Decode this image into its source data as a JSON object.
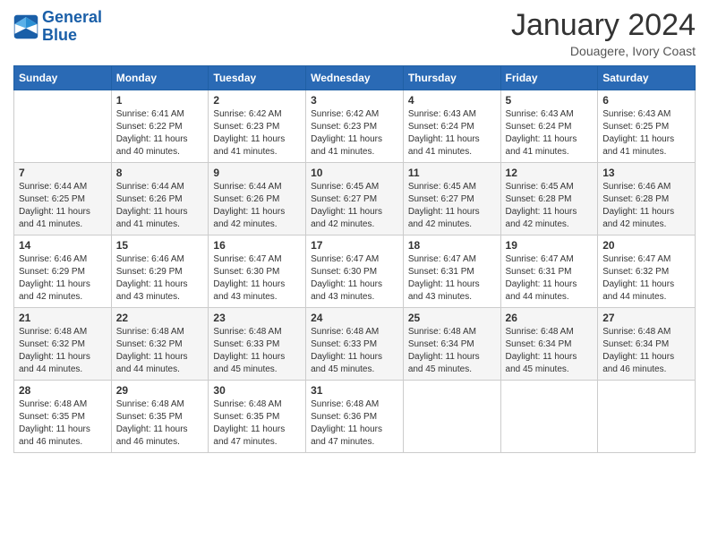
{
  "logo": {
    "line1": "General",
    "line2": "Blue"
  },
  "title": "January 2024",
  "subtitle": "Douagere, Ivory Coast",
  "days_header": [
    "Sunday",
    "Monday",
    "Tuesday",
    "Wednesday",
    "Thursday",
    "Friday",
    "Saturday"
  ],
  "weeks": [
    [
      {
        "day": "",
        "info": ""
      },
      {
        "day": "1",
        "info": "Sunrise: 6:41 AM\nSunset: 6:22 PM\nDaylight: 11 hours\nand 40 minutes."
      },
      {
        "day": "2",
        "info": "Sunrise: 6:42 AM\nSunset: 6:23 PM\nDaylight: 11 hours\nand 41 minutes."
      },
      {
        "day": "3",
        "info": "Sunrise: 6:42 AM\nSunset: 6:23 PM\nDaylight: 11 hours\nand 41 minutes."
      },
      {
        "day": "4",
        "info": "Sunrise: 6:43 AM\nSunset: 6:24 PM\nDaylight: 11 hours\nand 41 minutes."
      },
      {
        "day": "5",
        "info": "Sunrise: 6:43 AM\nSunset: 6:24 PM\nDaylight: 11 hours\nand 41 minutes."
      },
      {
        "day": "6",
        "info": "Sunrise: 6:43 AM\nSunset: 6:25 PM\nDaylight: 11 hours\nand 41 minutes."
      }
    ],
    [
      {
        "day": "7",
        "info": "Sunrise: 6:44 AM\nSunset: 6:25 PM\nDaylight: 11 hours\nand 41 minutes."
      },
      {
        "day": "8",
        "info": "Sunrise: 6:44 AM\nSunset: 6:26 PM\nDaylight: 11 hours\nand 41 minutes."
      },
      {
        "day": "9",
        "info": "Sunrise: 6:44 AM\nSunset: 6:26 PM\nDaylight: 11 hours\nand 42 minutes."
      },
      {
        "day": "10",
        "info": "Sunrise: 6:45 AM\nSunset: 6:27 PM\nDaylight: 11 hours\nand 42 minutes."
      },
      {
        "day": "11",
        "info": "Sunrise: 6:45 AM\nSunset: 6:27 PM\nDaylight: 11 hours\nand 42 minutes."
      },
      {
        "day": "12",
        "info": "Sunrise: 6:45 AM\nSunset: 6:28 PM\nDaylight: 11 hours\nand 42 minutes."
      },
      {
        "day": "13",
        "info": "Sunrise: 6:46 AM\nSunset: 6:28 PM\nDaylight: 11 hours\nand 42 minutes."
      }
    ],
    [
      {
        "day": "14",
        "info": "Sunrise: 6:46 AM\nSunset: 6:29 PM\nDaylight: 11 hours\nand 42 minutes."
      },
      {
        "day": "15",
        "info": "Sunrise: 6:46 AM\nSunset: 6:29 PM\nDaylight: 11 hours\nand 43 minutes."
      },
      {
        "day": "16",
        "info": "Sunrise: 6:47 AM\nSunset: 6:30 PM\nDaylight: 11 hours\nand 43 minutes."
      },
      {
        "day": "17",
        "info": "Sunrise: 6:47 AM\nSunset: 6:30 PM\nDaylight: 11 hours\nand 43 minutes."
      },
      {
        "day": "18",
        "info": "Sunrise: 6:47 AM\nSunset: 6:31 PM\nDaylight: 11 hours\nand 43 minutes."
      },
      {
        "day": "19",
        "info": "Sunrise: 6:47 AM\nSunset: 6:31 PM\nDaylight: 11 hours\nand 44 minutes."
      },
      {
        "day": "20",
        "info": "Sunrise: 6:47 AM\nSunset: 6:32 PM\nDaylight: 11 hours\nand 44 minutes."
      }
    ],
    [
      {
        "day": "21",
        "info": "Sunrise: 6:48 AM\nSunset: 6:32 PM\nDaylight: 11 hours\nand 44 minutes."
      },
      {
        "day": "22",
        "info": "Sunrise: 6:48 AM\nSunset: 6:32 PM\nDaylight: 11 hours\nand 44 minutes."
      },
      {
        "day": "23",
        "info": "Sunrise: 6:48 AM\nSunset: 6:33 PM\nDaylight: 11 hours\nand 45 minutes."
      },
      {
        "day": "24",
        "info": "Sunrise: 6:48 AM\nSunset: 6:33 PM\nDaylight: 11 hours\nand 45 minutes."
      },
      {
        "day": "25",
        "info": "Sunrise: 6:48 AM\nSunset: 6:34 PM\nDaylight: 11 hours\nand 45 minutes."
      },
      {
        "day": "26",
        "info": "Sunrise: 6:48 AM\nSunset: 6:34 PM\nDaylight: 11 hours\nand 45 minutes."
      },
      {
        "day": "27",
        "info": "Sunrise: 6:48 AM\nSunset: 6:34 PM\nDaylight: 11 hours\nand 46 minutes."
      }
    ],
    [
      {
        "day": "28",
        "info": "Sunrise: 6:48 AM\nSunset: 6:35 PM\nDaylight: 11 hours\nand 46 minutes."
      },
      {
        "day": "29",
        "info": "Sunrise: 6:48 AM\nSunset: 6:35 PM\nDaylight: 11 hours\nand 46 minutes."
      },
      {
        "day": "30",
        "info": "Sunrise: 6:48 AM\nSunset: 6:35 PM\nDaylight: 11 hours\nand 47 minutes."
      },
      {
        "day": "31",
        "info": "Sunrise: 6:48 AM\nSunset: 6:36 PM\nDaylight: 11 hours\nand 47 minutes."
      },
      {
        "day": "",
        "info": ""
      },
      {
        "day": "",
        "info": ""
      },
      {
        "day": "",
        "info": ""
      }
    ]
  ]
}
